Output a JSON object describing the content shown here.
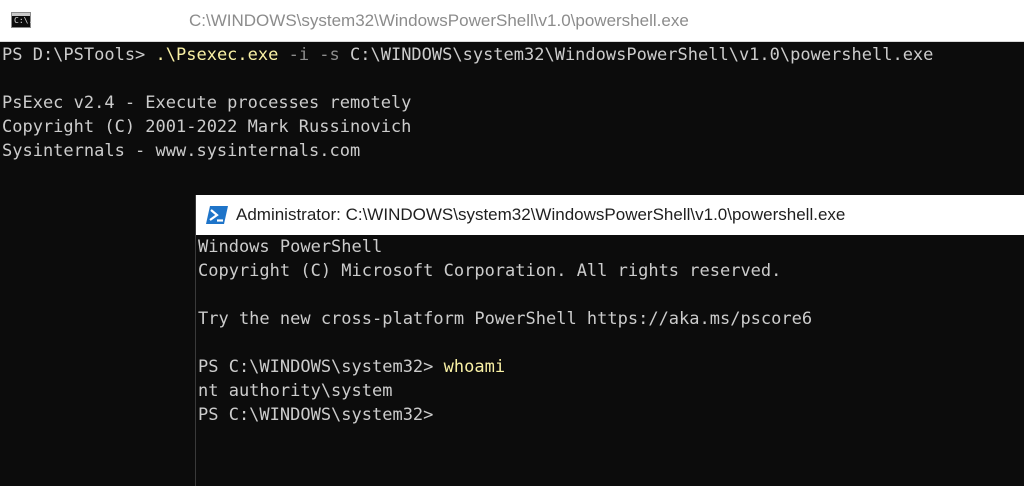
{
  "cmd_window": {
    "icon": "console-icon",
    "icon_glyph": "C:\\.",
    "title": "C:\\WINDOWS\\system32\\WindowsPowerShell\\v1.0\\powershell.exe",
    "prompt": "PS D:\\PSTools> ",
    "command": ".\\Psexec.exe",
    "args_flags": " -i -s ",
    "args_path": "C:\\WINDOWS\\system32\\WindowsPowerShell\\v1.0\\powershell.exe",
    "output": [
      "PsExec v2.4 - Execute processes remotely",
      "Copyright (C) 2001-2022 Mark Russinovich",
      "Sysinternals - www.sysinternals.com"
    ]
  },
  "ps_window": {
    "icon": "powershell-icon",
    "title": "Administrator: C:\\WINDOWS\\system32\\WindowsPowerShell\\v1.0\\powershell.exe",
    "banner": [
      "Windows PowerShell",
      "Copyright (C) Microsoft Corporation. All rights reserved."
    ],
    "tip": "Try the new cross-platform PowerShell https://aka.ms/pscore6",
    "prompt1": "PS C:\\WINDOWS\\system32> ",
    "command": "whoami",
    "result": "nt authority\\system",
    "prompt2": "PS C:\\WINDOWS\\system32>"
  },
  "colors": {
    "background": "#0c0c0c",
    "text": "#cccccc",
    "command": "#f9f1a5",
    "flag": "#8c8c8c",
    "ps_icon_blue": "#1e74c9"
  }
}
